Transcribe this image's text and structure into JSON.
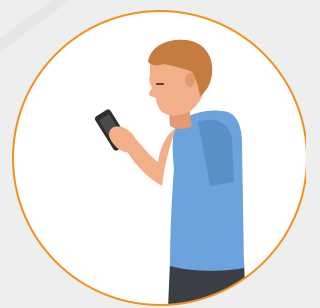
{
  "illustration": {
    "subject": "person-reading-phone",
    "icon": "smartphone-icon",
    "colors": {
      "background": "#eeeeee",
      "circle_fill": "#ffffff",
      "circle_ring": "#f0911e",
      "shirt": "#6ca3dc",
      "shirt_shade": "#5b8fc7",
      "skin": "#f2b08a",
      "skin_shade": "#e39a74",
      "hair": "#c47d3e",
      "pants": "#3a3f45",
      "phone": "#2e2e2e"
    }
  }
}
